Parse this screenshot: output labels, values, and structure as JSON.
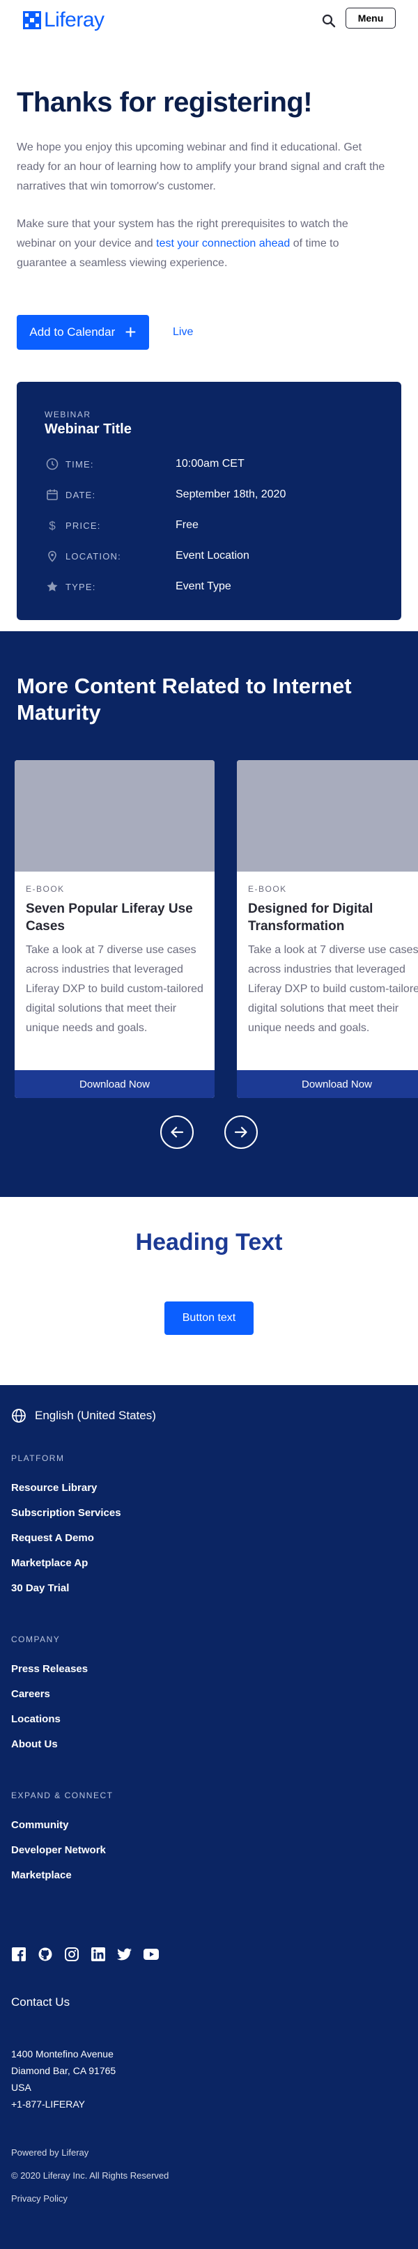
{
  "header": {
    "logo_text": "Liferay",
    "menu_label": "Menu"
  },
  "hero": {
    "title": "Thanks for registering!",
    "paragraph1": "We hope you enjoy this upcoming webinar and find it educational. Get ready for an hour of learning how to amplify your brand signal and craft the narratives that win tomorrow's customer.",
    "paragraph2_pre": "Make sure that your system has the right prerequisites to watch the webinar on your device and ",
    "paragraph2_link": "test your connection ahead",
    "paragraph2_post": " of time to guarantee a seamless viewing experience.",
    "calendar_button": "Add to Calendar",
    "live_link": "Live"
  },
  "webinar": {
    "eyebrow": "WEBINAR",
    "title": "Webinar Title",
    "rows": [
      {
        "icon": "clock-icon",
        "label": "TIME:",
        "value": "10:00am CET"
      },
      {
        "icon": "calendar-icon",
        "label": "DATE:",
        "value": "September 18th, 2020"
      },
      {
        "icon": "dollar-icon",
        "label": "PRICE:",
        "value": "Free"
      },
      {
        "icon": "location-pin-icon",
        "label": "LOCATION:",
        "value": "Event Location"
      },
      {
        "icon": "star-icon",
        "label": "TYPE:",
        "value": "Event Type"
      }
    ]
  },
  "related": {
    "heading": "More Content Related to Internet Maturity",
    "cards": [
      {
        "type": "E-BOOK",
        "title": "Seven Popular Liferay Use Cases",
        "description": "Take a look at 7 diverse use cases across industries that leveraged Liferay DXP to build custom-tailored digital solutions that meet their unique needs and goals.",
        "button": "Download Now"
      },
      {
        "type": "E-BOOK",
        "title": "Designed for Digital Transformation",
        "description": "Take a look at 7 diverse use cases across industries that leveraged Liferay DXP to build custom-tailored digital solutions that meet their unique needs and goals.",
        "button": "Download Now"
      }
    ]
  },
  "cta": {
    "heading": "Heading Text",
    "button": "Button text"
  },
  "footer": {
    "language": "English (United States)",
    "sections": [
      {
        "heading": "PLATFORM",
        "items": [
          "Resource Library",
          "Subscription Services",
          "Request A Demo",
          "Marketplace Ap",
          "30 Day Trial"
        ]
      },
      {
        "heading": "COMPANY",
        "items": [
          "Press Releases",
          "Careers",
          "Locations",
          "About Us"
        ]
      },
      {
        "heading": "EXPAND & CONNECT",
        "items": [
          "Community",
          "Developer Network",
          "Marketplace"
        ]
      }
    ],
    "socials": [
      "facebook-icon",
      "github-icon",
      "instagram-icon",
      "linkedin-icon",
      "twitter-icon",
      "youtube-icon"
    ],
    "contact_title": "Contact Us",
    "address_lines": [
      "1400 Montefino Avenue",
      "Diamond Bar, CA 91765",
      "USA",
      "+1-877-LIFERAY"
    ],
    "powered_by": "Powered by Liferay",
    "copyright": "© 2020 Liferay Inc. All Rights Reserved",
    "privacy": "Privacy Policy"
  },
  "colors": {
    "brand_blue": "#0b5fff",
    "navy": "#0b2563",
    "heading_navy": "#1c3a94"
  }
}
